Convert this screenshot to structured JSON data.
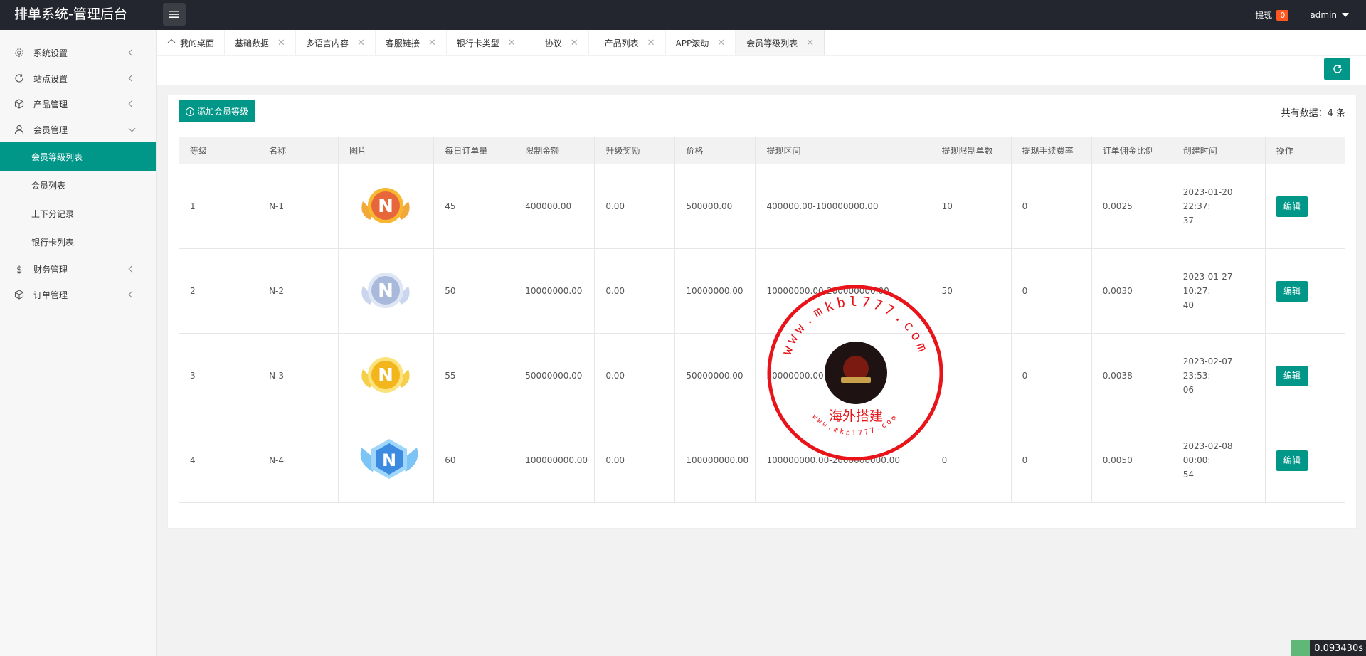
{
  "header": {
    "title": "排单系统-管理后台",
    "withdraw_label": "提现",
    "withdraw_count": "0",
    "user": "admin"
  },
  "sidebar": {
    "items": [
      {
        "label": "系统设置",
        "icon": "gear-icon"
      },
      {
        "label": "站点设置",
        "icon": "refresh-icon"
      },
      {
        "label": "产品管理",
        "icon": "box-icon"
      },
      {
        "label": "会员管理",
        "icon": "user-icon"
      },
      {
        "label": "财务管理",
        "icon": "dollar-icon"
      },
      {
        "label": "订单管理",
        "icon": "box-icon"
      }
    ],
    "sub_items": [
      "会员等级列表",
      "会员列表",
      "上下分记录",
      "银行卡列表"
    ]
  },
  "tabs": [
    "我的桌面",
    "基础数据",
    "多语言内容",
    "客服链接",
    "银行卡类型",
    "协议",
    "产品列表",
    "APP滚动",
    "会员等级列表"
  ],
  "panel": {
    "add_label": "添加会员等级",
    "total": "共有数据：4 条"
  },
  "table": {
    "headers": [
      "等级",
      "名称",
      "图片",
      "每日订单量",
      "限制金额",
      "升级奖励",
      "价格",
      "提现区间",
      "提现限制单数",
      "提现手续费率",
      "订单佣金比例",
      "创建时间",
      "操作"
    ],
    "edit_label": "编辑",
    "rows": [
      {
        "level": "1",
        "name": "N-1",
        "img": "orange-badge",
        "daily": "45",
        "limit": "400000.00",
        "reward": "0.00",
        "price": "500000.00",
        "range": "400000.00-100000000.00",
        "wd_count": "10",
        "fee": "0",
        "commission": "0.0025",
        "created_line1": "2023-01-20 22:37:",
        "created_line2": "37"
      },
      {
        "level": "2",
        "name": "N-2",
        "img": "silver-badge",
        "daily": "50",
        "limit": "10000000.00",
        "reward": "0.00",
        "price": "10000000.00",
        "range": "10000000.00-200000000.00",
        "wd_count": "50",
        "fee": "0",
        "commission": "0.0030",
        "created_line1": "2023-01-27 10:27:",
        "created_line2": "40"
      },
      {
        "level": "3",
        "name": "N-3",
        "img": "gold-badge",
        "daily": "55",
        "limit": "50000000.00",
        "reward": "0.00",
        "price": "50000000.00",
        "range": "50000000.00-6",
        "wd_count": "",
        "fee": "0",
        "commission": "0.0038",
        "created_line1": "2023-02-07 23:53:",
        "created_line2": "06"
      },
      {
        "level": "4",
        "name": "N-4",
        "img": "diamond-badge",
        "daily": "60",
        "limit": "100000000.00",
        "reward": "0.00",
        "price": "100000000.00",
        "range": "100000000.00-2000000000.00",
        "wd_count": "0",
        "fee": "0",
        "commission": "0.0050",
        "created_line1": "2023-02-08 00:00:",
        "created_line2": "54"
      }
    ]
  },
  "watermark": {
    "url_top": "www.mkbl777.com",
    "text": "海外搭建",
    "url_bottom": "www.mkbl777.com"
  },
  "timer": "0.093430s",
  "colors": {
    "accent": "#009688",
    "header": "#23262e",
    "badge": "#ff5722",
    "stamp": "#e8141a"
  }
}
